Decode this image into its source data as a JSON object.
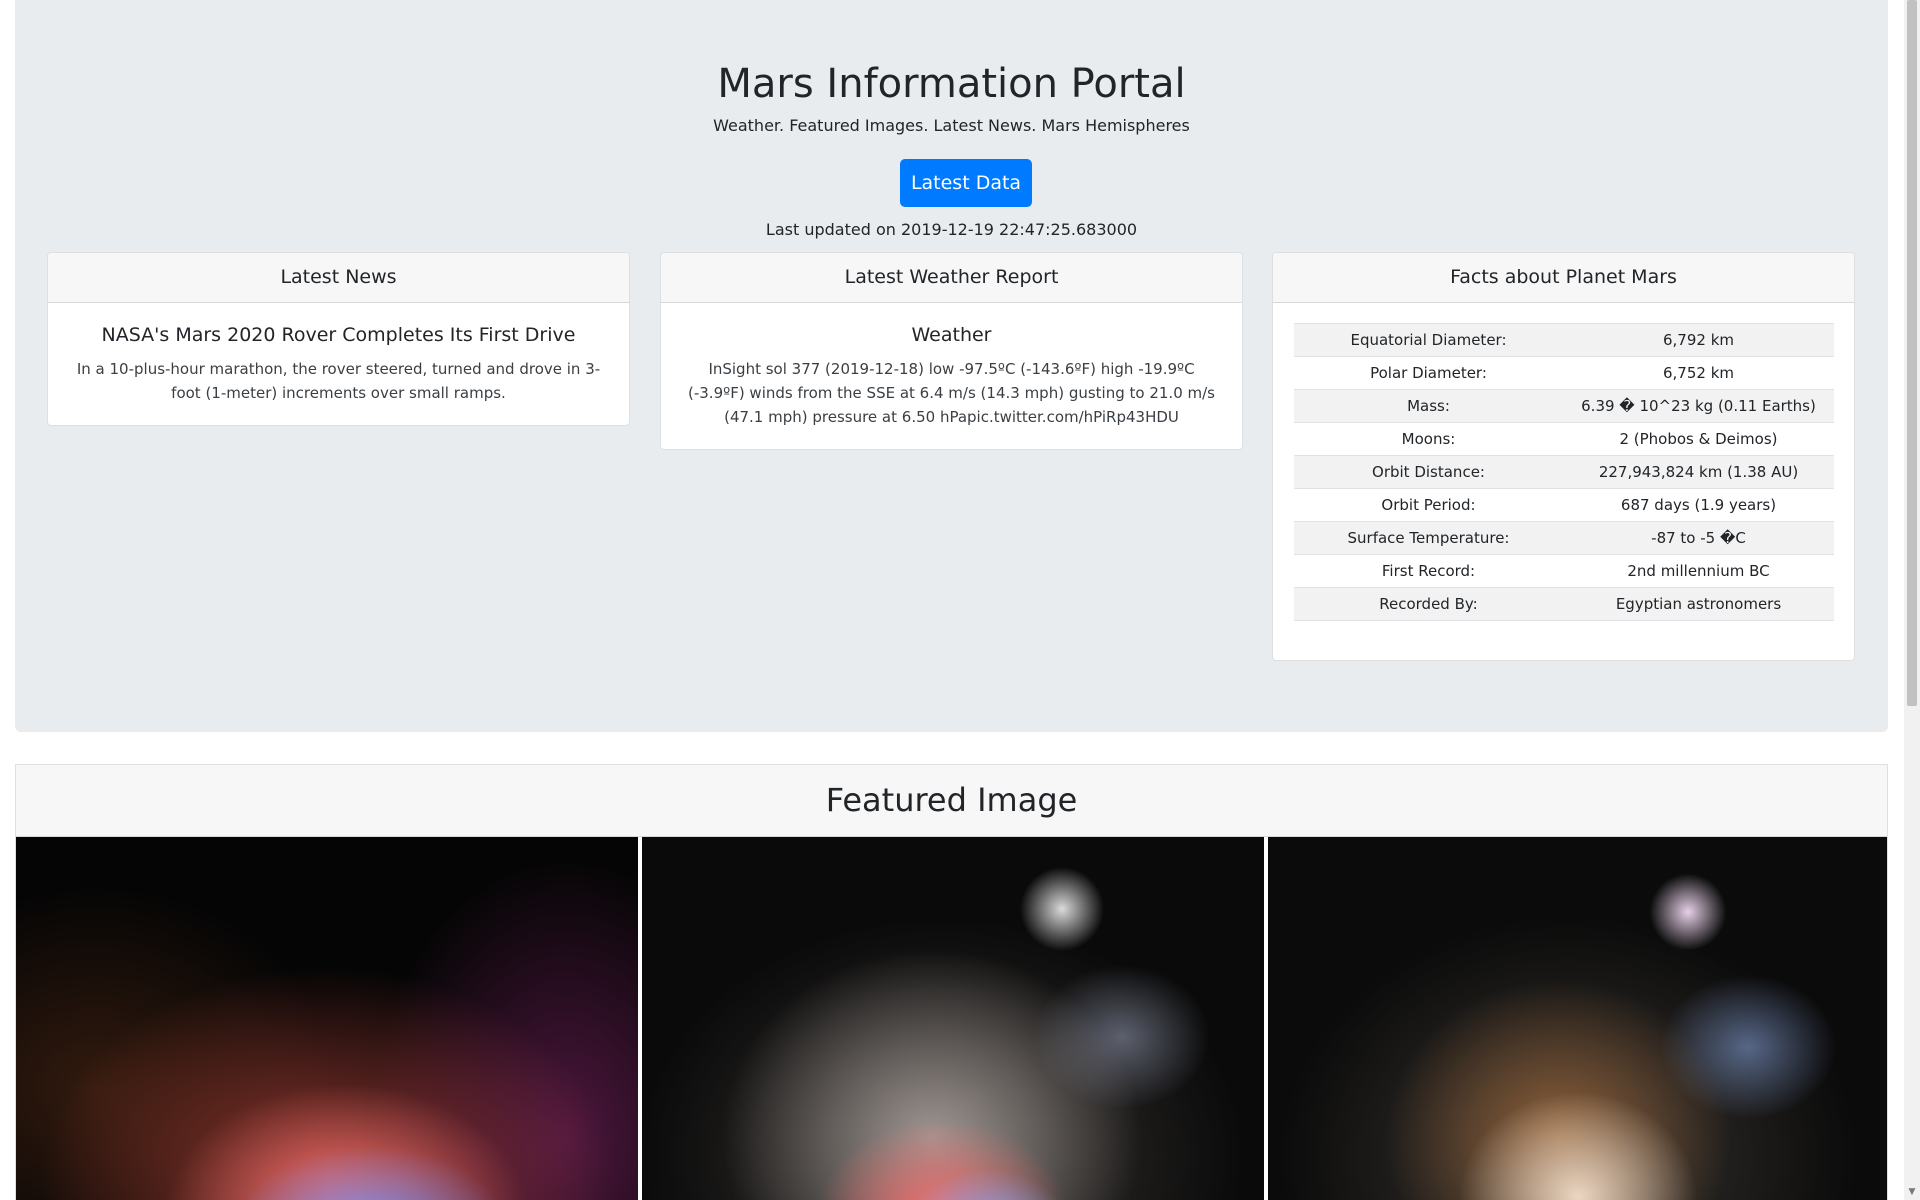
{
  "header": {
    "title": "Mars Information Portal",
    "subtitle": "Weather. Featured Images. Latest News. Mars Hemispheres",
    "button_label": "Latest Data",
    "last_updated": "Last updated on 2019-12-19 22:47:25.683000"
  },
  "news": {
    "header": "Latest News",
    "title": "NASA's Mars 2020 Rover Completes Its First Drive",
    "text": "In a 10-plus-hour marathon, the rover steered, turned and drove in 3-foot (1-meter) increments over small ramps."
  },
  "weather": {
    "header": "Latest Weather Report",
    "title": "Weather",
    "text": "InSight sol 377 (2019-12-18) low -97.5ºC (-143.6ºF) high -19.9ºC (-3.9ºF) winds from the SSE at 6.4 m/s (14.3 mph) gusting to 21.0 m/s (47.1 mph) pressure at 6.50 hPapic.twitter.com/hPiRp43HDU"
  },
  "facts": {
    "header": "Facts about Planet Mars",
    "rows": [
      {
        "label": "Equatorial Diameter:",
        "value": "6,792 km"
      },
      {
        "label": "Polar Diameter:",
        "value": "6,752 km"
      },
      {
        "label": "Mass:",
        "value": "6.39 � 10^23 kg (0.11 Earths)"
      },
      {
        "label": "Moons:",
        "value": "2 (Phobos & Deimos)"
      },
      {
        "label": "Orbit Distance:",
        "value": "227,943,824 km (1.38 AU)"
      },
      {
        "label": "Orbit Period:",
        "value": "687 days (1.9 years)"
      },
      {
        "label": "Surface Temperature:",
        "value": "-87 to -5 �C"
      },
      {
        "label": "First Record:",
        "value": "2nd millennium BC"
      },
      {
        "label": "Recorded By:",
        "value": "Egyptian astronomers"
      }
    ]
  },
  "featured": {
    "header": "Featured Image"
  },
  "colors": {
    "jumbotron_bg": "#e9ecef",
    "button_primary": "#007bff",
    "card_header_bg": "#f7f7f7"
  }
}
